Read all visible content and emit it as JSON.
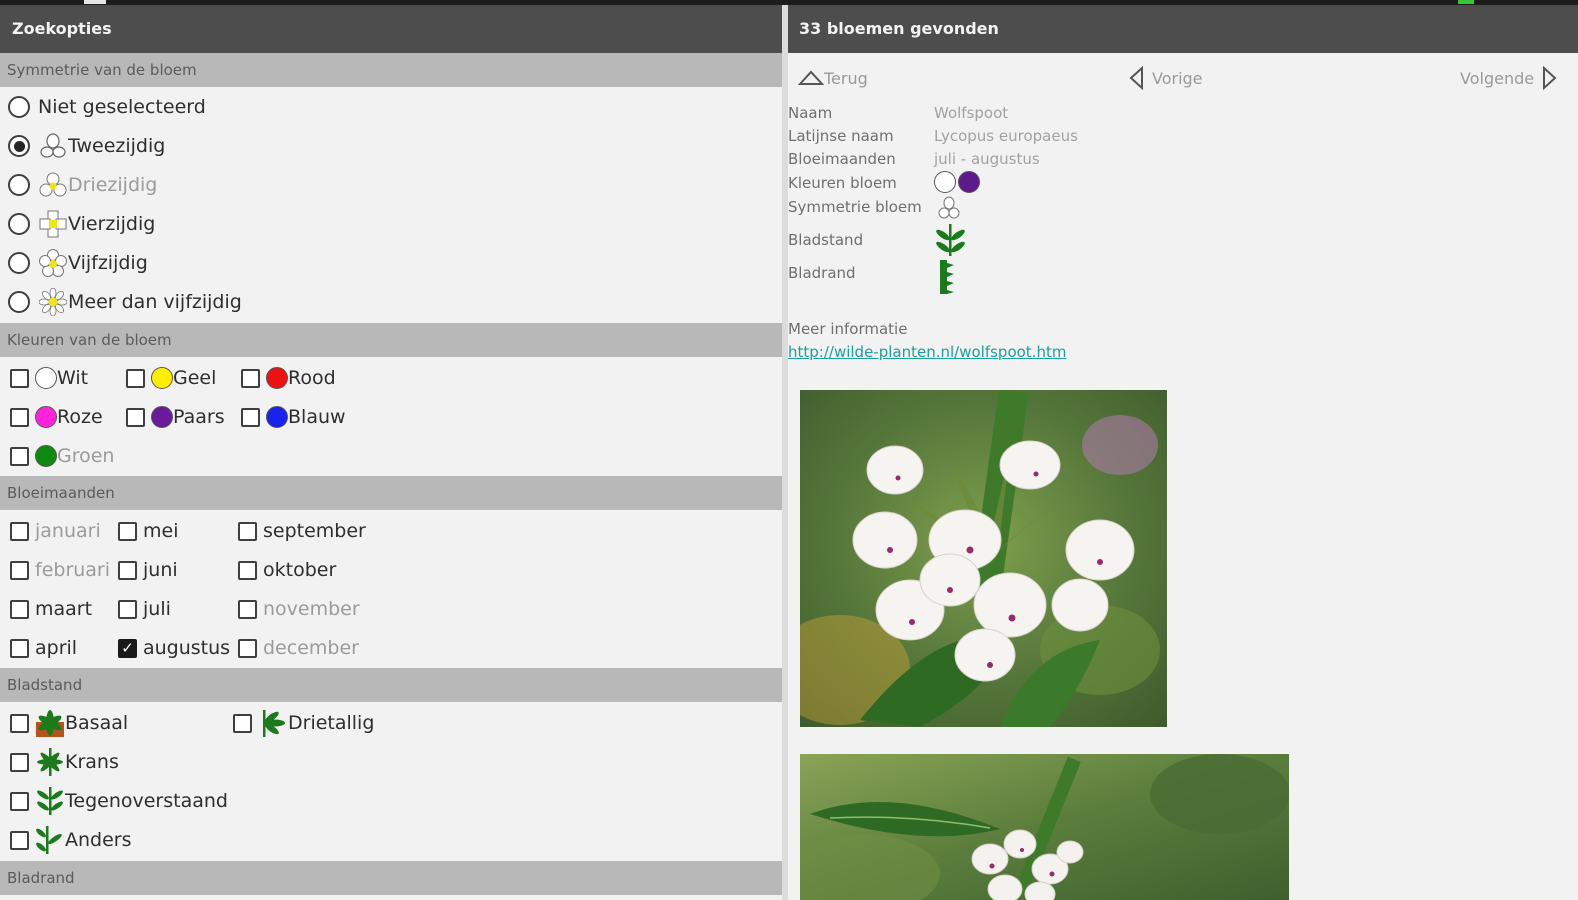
{
  "left": {
    "title": "Zoekopties",
    "sections": {
      "symmetry": "Symmetrie van de bloem",
      "colors": "Kleuren van de bloem",
      "months": "Bloeimaanden",
      "leafarrangement": "Bladstand",
      "leafmargin": "Bladrand"
    },
    "symmetry_options": [
      {
        "label": "Niet geselecteerd",
        "selected": false
      },
      {
        "label": "Tweezijdig",
        "selected": true
      },
      {
        "label": "Driezijdig",
        "selected": false
      },
      {
        "label": "Vierzijdig",
        "selected": false
      },
      {
        "label": "Vijfzijdig",
        "selected": false
      },
      {
        "label": "Meer dan vijfzijdig",
        "selected": false
      }
    ],
    "colors": [
      {
        "label": "Wit",
        "color": "#ffffff"
      },
      {
        "label": "Geel",
        "color": "#ffee00"
      },
      {
        "label": "Rood",
        "color": "#ee1111"
      },
      {
        "label": "Roze",
        "color": "#ff22dd"
      },
      {
        "label": "Paars",
        "color": "#6a1a9a"
      },
      {
        "label": "Blauw",
        "color": "#1a22ee"
      },
      {
        "label": "Groen",
        "color": "#0e8a0e"
      }
    ],
    "months": [
      {
        "label": "januari",
        "checked": false
      },
      {
        "label": "februari",
        "checked": false
      },
      {
        "label": "maart",
        "checked": false
      },
      {
        "label": "april",
        "checked": false
      },
      {
        "label": "mei",
        "checked": false
      },
      {
        "label": "juni",
        "checked": false
      },
      {
        "label": "juli",
        "checked": false
      },
      {
        "label": "augustus",
        "checked": true
      },
      {
        "label": "september",
        "checked": false
      },
      {
        "label": "oktober",
        "checked": false
      },
      {
        "label": "november",
        "checked": false
      },
      {
        "label": "december",
        "checked": false
      }
    ],
    "leaf_arrangement": [
      {
        "label": "Basaal"
      },
      {
        "label": "Drietallig"
      },
      {
        "label": "Krans"
      },
      {
        "label": "Tegenoverstaand"
      },
      {
        "label": "Anders"
      }
    ]
  },
  "right": {
    "title": "33 bloemen gevonden",
    "nav": {
      "back": "Terug",
      "prev": "Vorige",
      "next": "Volgende"
    },
    "details": {
      "name_label": "Naam",
      "name_value": "Wolfspoot",
      "latin_label": "Latijnse naam",
      "latin_value": "Lycopus europaeus",
      "months_label": "Bloeimaanden",
      "months_value": "juli - augustus",
      "colors_label": "Kleuren bloem",
      "symmetry_label": "Symmetrie bloem",
      "arrangement_label": "Bladstand",
      "margin_label": "Bladrand"
    },
    "flower_colors": [
      "#ffffff",
      "#5e1a8c"
    ],
    "more_info_label": "Meer informatie",
    "more_info_link": "http://wilde-planten.nl/wolfspoot.htm"
  },
  "theme": {
    "titlebar": "#4d4d4d",
    "section": "#b8b8b8",
    "link": "#1d9f9a"
  }
}
